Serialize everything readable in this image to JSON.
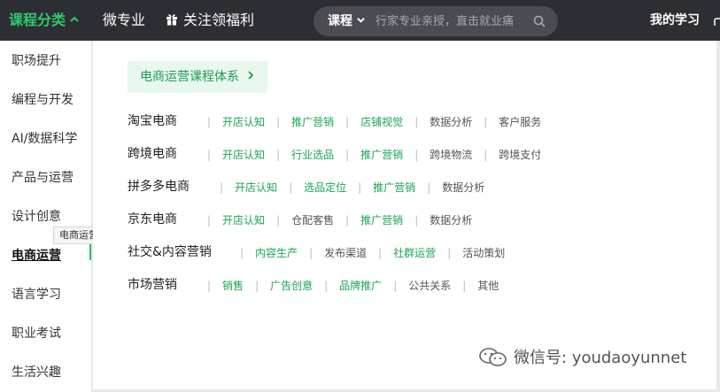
{
  "topbar": {
    "category_label": "课程分类",
    "micro_label": "微专业",
    "welfare_label": "关注领福利",
    "search": {
      "type_label": "课程",
      "placeholder": "行家专业亲授，直击就业痛"
    },
    "my_learning_label": "我的学习"
  },
  "sidebar": {
    "items": [
      {
        "label": "职场提升"
      },
      {
        "label": "编程与开发"
      },
      {
        "label": "AI/数据科学"
      },
      {
        "label": "产品与运营"
      },
      {
        "label": "设计创意"
      },
      {
        "label": "电商运营"
      },
      {
        "label": "语言学习"
      },
      {
        "label": "职业考试"
      },
      {
        "label": "生活兴趣"
      }
    ],
    "tooltip": "电商运营"
  },
  "panel": {
    "system_label": "电商运营课程体系",
    "rows": [
      {
        "title": "淘宝电商",
        "tags": [
          {
            "label": "开店认知",
            "hot": true
          },
          {
            "label": "推广营销",
            "hot": true
          },
          {
            "label": "店铺视觉",
            "hot": true
          },
          {
            "label": "数据分析",
            "hot": false
          },
          {
            "label": "客户服务",
            "hot": false
          }
        ]
      },
      {
        "title": "跨境电商",
        "tags": [
          {
            "label": "开店认知",
            "hot": true
          },
          {
            "label": "行业选品",
            "hot": true
          },
          {
            "label": "推广营销",
            "hot": true
          },
          {
            "label": "跨境物流",
            "hot": false
          },
          {
            "label": "跨境支付",
            "hot": false
          }
        ]
      },
      {
        "title": "拼多多电商",
        "tags": [
          {
            "label": "开店认知",
            "hot": true
          },
          {
            "label": "选品定位",
            "hot": true
          },
          {
            "label": "推广营销",
            "hot": true
          },
          {
            "label": "数据分析",
            "hot": false
          }
        ]
      },
      {
        "title": "京东电商",
        "tags": [
          {
            "label": "开店认知",
            "hot": true
          },
          {
            "label": "仓配客售",
            "hot": false
          },
          {
            "label": "推广营销",
            "hot": true
          },
          {
            "label": "数据分析",
            "hot": false
          }
        ]
      },
      {
        "title": "社交&内容营销",
        "tags": [
          {
            "label": "内容生产",
            "hot": true
          },
          {
            "label": "发布渠道",
            "hot": false
          },
          {
            "label": "社群运营",
            "hot": true
          },
          {
            "label": "活动策划",
            "hot": false
          }
        ]
      },
      {
        "title": "市场营销",
        "tags": [
          {
            "label": "销售",
            "hot": true
          },
          {
            "label": "广告创意",
            "hot": true
          },
          {
            "label": "品牌推广",
            "hot": true
          },
          {
            "label": "公共关系",
            "hot": false
          },
          {
            "label": "其他",
            "hot": false
          }
        ]
      }
    ]
  },
  "watermark": {
    "text": "微信号: youdaoyunnet"
  },
  "colors": {
    "topbar": "#2d2e33",
    "accent_green": "#2fcb6e",
    "tag_green": "#1aa551"
  }
}
